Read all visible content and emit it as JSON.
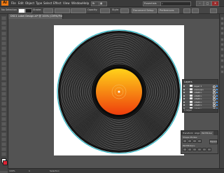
{
  "app": {
    "logo": "Ai",
    "menus": [
      "File",
      "Edit",
      "Object",
      "Type",
      "Select",
      "Effect",
      "View",
      "Window",
      "Help"
    ]
  },
  "menubar_right": {
    "workspace": "Essentials",
    "search_placeholder": "",
    "min_label": "–",
    "max_label": "□",
    "close_label": "✕"
  },
  "control_bar": {
    "selection_label": "No Selection",
    "stroke_label": "Stroke:",
    "opacity_label": "Opacity:",
    "style_label": "Style:",
    "doc_setup_label": "Document Setup",
    "preferences_label": "Preferences"
  },
  "document_tab": {
    "title": "DSC1 Label Design.ai* @ 100% (CMYK/Preview)"
  },
  "artwork": {
    "record_color": "#141414",
    "groove_color": "#bfbfbf",
    "rim_color": "#2ab5c4",
    "label_gradient_start": "#ffd21a",
    "label_gradient_end": "#ee3d0c"
  },
  "layers_panel": {
    "title": "Layers",
    "rows": [
      "Layer 1",
      "<Group>",
      "<Path>",
      "<Path>",
      "<Path>",
      "<Path>",
      "<Path>",
      "<Path>"
    ],
    "footer": "1 Layer"
  },
  "pathfinder_panel": {
    "tabs": [
      "Transform",
      "Align",
      "Pathfinder"
    ],
    "shape_modes_label": "Shape Modes:",
    "pathfinders_label": "Pathfinders:",
    "expand_label": "Expand"
  },
  "status_bar": {
    "zoom": "100%",
    "artboard": "1",
    "tool": "Selection"
  },
  "colors": {
    "accent": "#ee7a13",
    "selection_blue": "#4aa0ff"
  },
  "icons": [
    "selection-icon",
    "direct-selection-icon",
    "magic-wand-icon",
    "lasso-icon",
    "pen-icon",
    "type-icon",
    "line-icon",
    "rectangle-icon",
    "paintbrush-icon",
    "pencil-icon",
    "blob-brush-icon",
    "eraser-icon",
    "rotate-icon",
    "scale-icon",
    "width-icon",
    "free-transform-icon",
    "shape-builder-icon",
    "perspective-icon",
    "mesh-icon",
    "gradient-icon",
    "eyedropper-icon",
    "blend-icon",
    "symbol-sprayer-icon",
    "graph-icon",
    "artboard-icon",
    "slice-icon",
    "hand-icon",
    "zoom-icon"
  ]
}
